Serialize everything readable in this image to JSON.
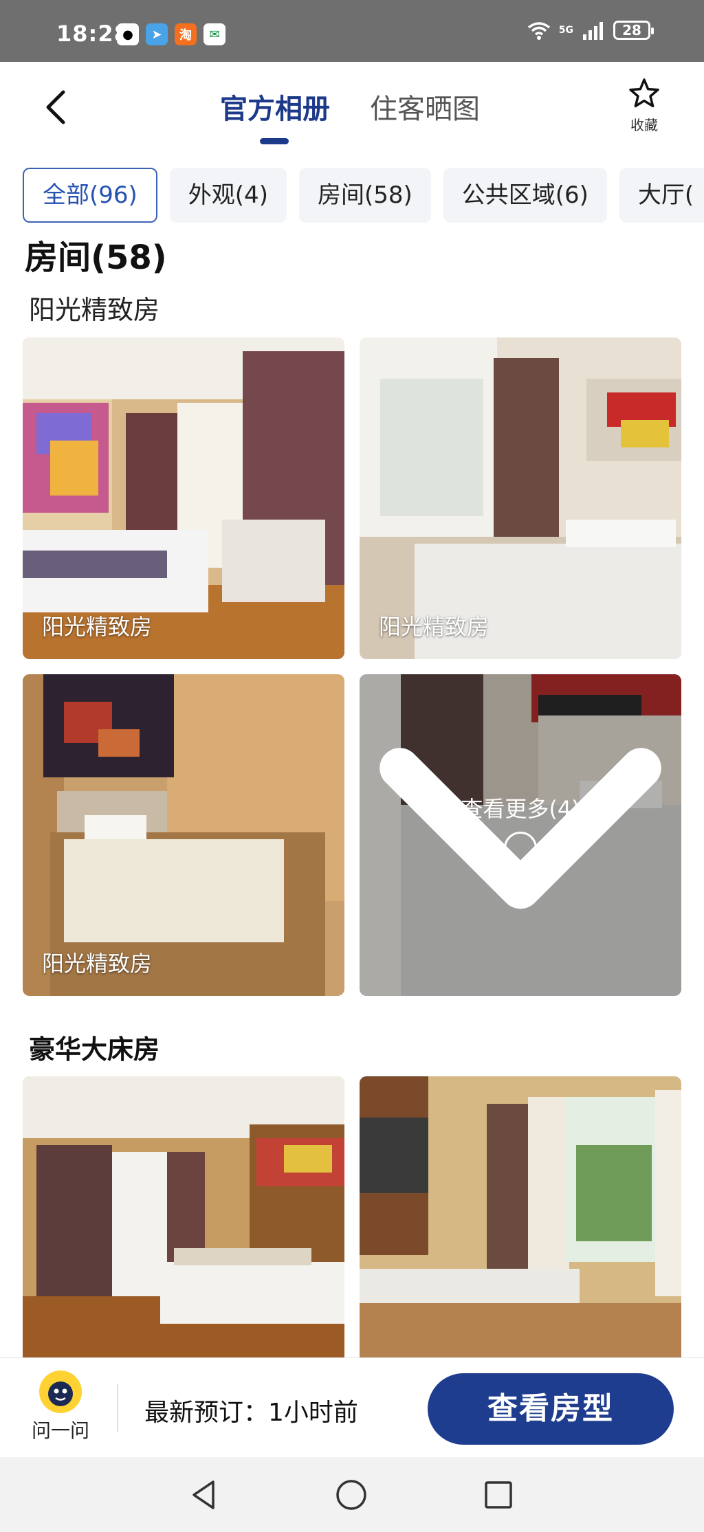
{
  "status_bar": {
    "time": "18:28",
    "network": "5G",
    "battery": "28"
  },
  "header": {
    "tabs": [
      {
        "label": "官方相册"
      },
      {
        "label": "住客晒图"
      }
    ],
    "favorite_label": "收藏"
  },
  "categories": [
    {
      "label": "全部(96)"
    },
    {
      "label": "外观(4)"
    },
    {
      "label": "房间(58)"
    },
    {
      "label": "公共区域(6)"
    },
    {
      "label": "大厅("
    }
  ],
  "section": {
    "title": "房间(58)"
  },
  "groups": [
    {
      "title": "阳光精致房",
      "photos": [
        {
          "caption": "阳光精致房"
        },
        {
          "caption": "阳光精致房"
        },
        {
          "caption": "阳光精致房"
        }
      ],
      "more_label": "查看更多(4)"
    },
    {
      "title": "豪华大床房"
    }
  ],
  "bottom_bar": {
    "ask_label": "问一问",
    "booking_text": "最新预订：1小时前",
    "cta_label": "查看房型"
  },
  "colors": {
    "accent": "#1f3d8f",
    "chip_active_border": "#3a63b8"
  }
}
